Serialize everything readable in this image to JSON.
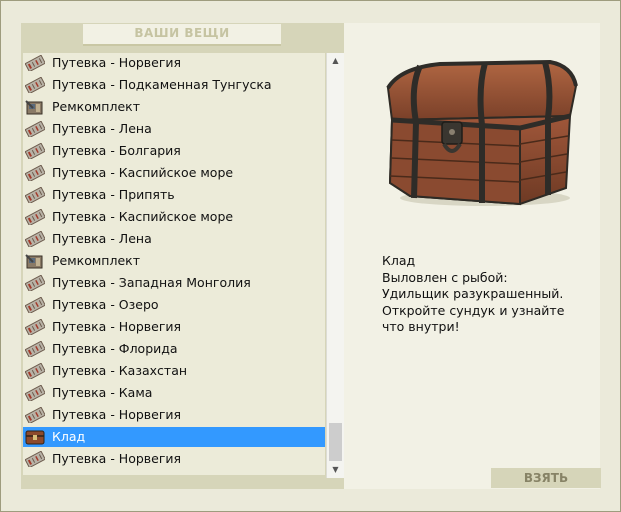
{
  "panel": {
    "title": "ВАШИ ВЕЩИ"
  },
  "items": [
    {
      "label": "Путевка - Норвегия",
      "icon": "ticket-icon",
      "selected": false
    },
    {
      "label": "Путевка - Подкаменная Тунгуска",
      "icon": "ticket-icon",
      "selected": false
    },
    {
      "label": "Ремкомплект",
      "icon": "repair-kit-icon",
      "selected": false
    },
    {
      "label": "Путевка - Лена",
      "icon": "ticket-icon",
      "selected": false
    },
    {
      "label": "Путевка - Болгария",
      "icon": "ticket-icon",
      "selected": false
    },
    {
      "label": "Путевка - Каспийское море",
      "icon": "ticket-icon",
      "selected": false
    },
    {
      "label": "Путевка - Припять",
      "icon": "ticket-icon",
      "selected": false
    },
    {
      "label": "Путевка - Каспийское море",
      "icon": "ticket-icon",
      "selected": false
    },
    {
      "label": "Путевка - Лена",
      "icon": "ticket-icon",
      "selected": false
    },
    {
      "label": "Ремкомплект",
      "icon": "repair-kit-icon",
      "selected": false
    },
    {
      "label": "Путевка - Западная Монголия",
      "icon": "ticket-icon",
      "selected": false
    },
    {
      "label": "Путевка - Озеро",
      "icon": "ticket-icon",
      "selected": false
    },
    {
      "label": "Путевка - Норвегия",
      "icon": "ticket-icon",
      "selected": false
    },
    {
      "label": "Путевка - Флорида",
      "icon": "ticket-icon",
      "selected": false
    },
    {
      "label": "Путевка - Казахстан",
      "icon": "ticket-icon",
      "selected": false
    },
    {
      "label": "Путевка - Кама",
      "icon": "ticket-icon",
      "selected": false
    },
    {
      "label": "Путевка - Норвегия",
      "icon": "ticket-icon",
      "selected": false
    },
    {
      "label": "Клад",
      "icon": "treasure-chest-icon",
      "selected": true
    },
    {
      "label": "Путевка - Норвегия",
      "icon": "ticket-icon",
      "selected": false
    }
  ],
  "details": {
    "image": "treasure-chest-image",
    "lines": [
      "Клад",
      "Выловлен с рыбой:",
      "Удильщик разукрашенный.",
      "Откройте сундук и узнайте",
      "что внутри!"
    ]
  },
  "actions": {
    "take_label": "ВЗЯТЬ"
  },
  "colors": {
    "selection": "#3399ff",
    "panel": "#d6d5b9",
    "list_background": "#ecebd9"
  }
}
